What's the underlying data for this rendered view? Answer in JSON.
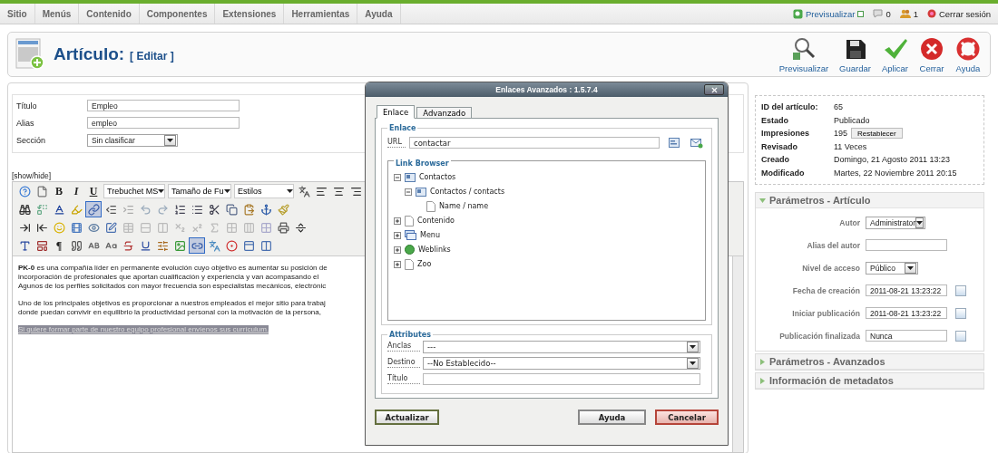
{
  "top_menu": [
    "Sitio",
    "Menús",
    "Contenido",
    "Componentes",
    "Extensiones",
    "Herramientas",
    "Ayuda"
  ],
  "top_status": {
    "preview": "Previsualizar",
    "messages": "0",
    "users": "1",
    "logout": "Cerrar sesión"
  },
  "header": {
    "title": "Artículo:",
    "subtitle": "[ Editar ]",
    "actions": [
      "Previsualizar",
      "Guardar",
      "Aplicar",
      "Cerrar",
      "Ayuda"
    ]
  },
  "form": [
    {
      "label": "Título",
      "kind": "input",
      "value": "Empleo"
    },
    {
      "label": "Alias",
      "kind": "input",
      "value": "empleo"
    },
    {
      "label": "Sección",
      "kind": "select",
      "value": "Sin clasificar"
    }
  ],
  "editor": {
    "toggle": "[show/hide]",
    "toolbar": [
      [
        {
          "kind": "icon",
          "active": false
        },
        {
          "kind": "icon",
          "active": false
        },
        {
          "kind": "text",
          "label": "B",
          "active": false
        },
        {
          "kind": "text",
          "label": "I",
          "active": false
        },
        {
          "kind": "text",
          "label": "U",
          "active": false
        },
        {
          "kind": "select",
          "value": "Trebuchet MS"
        },
        {
          "kind": "select",
          "value": "Tamaño de Fu"
        },
        {
          "kind": "select",
          "value": "Estilos"
        },
        {
          "kind": "icon",
          "active": false
        },
        {
          "kind": "icon",
          "active": false
        },
        {
          "kind": "icon",
          "active": false
        },
        {
          "kind": "icon",
          "active": false
        }
      ],
      [
        {
          "kind": "icon",
          "active": false
        },
        {
          "kind": "icon",
          "active": false
        },
        {
          "kind": "icon",
          "active": false
        },
        {
          "kind": "icon",
          "active": false
        },
        {
          "kind": "icon",
          "active": true
        },
        {
          "kind": "icon",
          "active": false
        },
        {
          "kind": "icon",
          "active": false
        },
        {
          "kind": "icon",
          "active": false
        },
        {
          "kind": "icon",
          "active": false
        },
        {
          "kind": "icon",
          "active": false
        },
        {
          "kind": "icon",
          "active": false
        },
        {
          "kind": "icon",
          "active": false
        },
        {
          "kind": "icon",
          "active": false
        },
        {
          "kind": "icon",
          "active": false
        },
        {
          "kind": "icon",
          "active": false
        },
        {
          "kind": "icon",
          "active": false
        }
      ],
      [
        {
          "kind": "icon",
          "active": false
        },
        {
          "kind": "icon",
          "active": false
        },
        {
          "kind": "icon",
          "active": false
        },
        {
          "kind": "icon",
          "active": false
        },
        {
          "kind": "icon",
          "active": false
        },
        {
          "kind": "icon",
          "active": false
        },
        {
          "kind": "icon",
          "active": false
        },
        {
          "kind": "icon",
          "active": false
        },
        {
          "kind": "icon",
          "active": false
        },
        {
          "kind": "icon",
          "active": false
        },
        {
          "kind": "icon",
          "active": false
        },
        {
          "kind": "icon",
          "active": false
        },
        {
          "kind": "icon",
          "active": false
        },
        {
          "kind": "icon",
          "active": false
        },
        {
          "kind": "icon",
          "active": false
        },
        {
          "kind": "icon",
          "active": false
        },
        {
          "kind": "icon",
          "active": false
        }
      ],
      [
        {
          "kind": "icon",
          "active": false
        },
        {
          "kind": "icon",
          "active": false
        },
        {
          "kind": "text",
          "label": "¶",
          "active": false
        },
        {
          "kind": "icon",
          "active": false
        },
        {
          "kind": "icon",
          "active": false
        },
        {
          "kind": "icon",
          "active": false
        },
        {
          "kind": "icon",
          "active": false
        },
        {
          "kind": "icon",
          "active": false
        },
        {
          "kind": "icon",
          "active": false
        },
        {
          "kind": "icon",
          "active": false
        },
        {
          "kind": "icon",
          "active": true
        },
        {
          "kind": "icon",
          "active": false
        },
        {
          "kind": "icon",
          "active": false
        },
        {
          "kind": "icon",
          "active": false
        },
        {
          "kind": "icon",
          "active": false
        }
      ]
    ],
    "paragraphs": [
      {
        "selected": false,
        "lines": [
          "**PK-0** es una compañía líder en permanente evolución cuyo objetivo es aumentar su posición de",
          "incorporación de profesionales que aportan cualificación y experiencia y van acompasando el",
          "Agunos de los perfiles solicitados con mayor frecuencia son especialistas mecánicos, electrónic"
        ]
      },
      {
        "selected": false,
        "lines": [
          "Uno de los principales objetivos es proporcionar a nuestros empleados el mejor sitio para trabaj",
          "donde puedan convivir en equilibrio la productividad personal con la motivación de la persona,"
        ]
      },
      {
        "selected": true,
        "lines": [
          "Si quiere formar parte de nuestro equipo profesional envíenos sus currículum."
        ]
      }
    ]
  },
  "details": [
    {
      "label": "ID del artículo:",
      "value": "65"
    },
    {
      "label": "Estado",
      "value": "Publicado"
    },
    {
      "label": "Impresiones",
      "value": "195",
      "button": "Restablecer"
    },
    {
      "label": "Revisado",
      "value": "11 Veces"
    },
    {
      "label": "Creado",
      "value": "Domingo, 21 Agosto 2011 13:23"
    },
    {
      "label": "Modificado",
      "value": "Martes, 22 Noviembre 2011 20:15"
    }
  ],
  "panels": [
    {
      "title": "Parámetros - Artículo",
      "expanded": true,
      "params": [
        {
          "label": "Autor",
          "kind": "select",
          "value": "Administrator"
        },
        {
          "label": "Alias del autor",
          "kind": "input"
        },
        {
          "label": "Nivel de acceso",
          "kind": "select",
          "value": "Público"
        },
        {
          "label": "Fecha de creación",
          "kind": "date",
          "value": "2011-08-21 13:23:22"
        },
        {
          "label": "Iniciar publicación",
          "kind": "date",
          "value": "2011-08-21 13:23:22"
        },
        {
          "label": "Publicación finalizada",
          "kind": "date",
          "value": "Nunca"
        }
      ]
    },
    {
      "title": "Parámetros - Avanzados",
      "expanded": false
    },
    {
      "title": "Información de metadatos",
      "expanded": false
    }
  ],
  "dialog": {
    "title": "Enlaces Avanzados : 1.5.7.4",
    "tabs": [
      {
        "label": "Enlace",
        "selected": true
      },
      {
        "label": "Advanzado",
        "selected": false
      }
    ],
    "link_legend": "Enlace",
    "url_label": "URL",
    "url_value": "contactar",
    "browser_legend": "Link Browser",
    "tree": [
      {
        "label": "Contactos",
        "kind": "contacts",
        "expanded": true,
        "children": [
          {
            "label": "Contactos / contacts",
            "kind": "contacts",
            "expanded": true,
            "children": [
              {
                "label": "Name / name",
                "kind": "page"
              }
            ]
          }
        ]
      },
      {
        "label": "Contenido",
        "kind": "page",
        "expanded": false
      },
      {
        "label": "Menu",
        "kind": "menu",
        "expanded": false
      },
      {
        "label": "Weblinks",
        "kind": "globe",
        "expanded": false
      },
      {
        "label": "Zoo",
        "kind": "page",
        "expanded": false
      }
    ],
    "attributes_legend": "Attributes",
    "attributes": [
      {
        "label": "Anclas",
        "kind": "select",
        "value": "---"
      },
      {
        "label": "Destino",
        "kind": "select",
        "value": "--No Establecido--"
      },
      {
        "label": "Título",
        "kind": "input"
      }
    ],
    "buttons": [
      {
        "label": "Actualizar",
        "kind": "primary"
      },
      {
        "label": "Ayuda",
        "kind": "default"
      },
      {
        "label": "Cancelar",
        "kind": "danger"
      }
    ]
  }
}
